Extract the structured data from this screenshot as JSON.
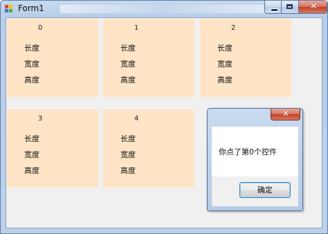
{
  "window": {
    "title": "Form1",
    "caption_buttons": {
      "minimize": "minimize-icon",
      "maximize": "maximize-icon",
      "close": "close-icon"
    }
  },
  "panels": [
    {
      "index": "0",
      "labels": [
        "长度",
        "宽度",
        "高度"
      ]
    },
    {
      "index": "1",
      "labels": [
        "长度",
        "宽度",
        "高度"
      ]
    },
    {
      "index": "2",
      "labels": [
        "长度",
        "宽度",
        "高度"
      ]
    },
    {
      "index": "3",
      "labels": [
        "长度",
        "宽度",
        "高度"
      ]
    },
    {
      "index": "4",
      "labels": [
        "长度",
        "宽度",
        "高度"
      ]
    }
  ],
  "message_box": {
    "text": "你点了第0个控件",
    "ok_label": "确定"
  },
  "colors": {
    "panel_bg": "#ffe4c6",
    "client_bg": "#f0f0f0",
    "close_button": "#c3402a"
  }
}
